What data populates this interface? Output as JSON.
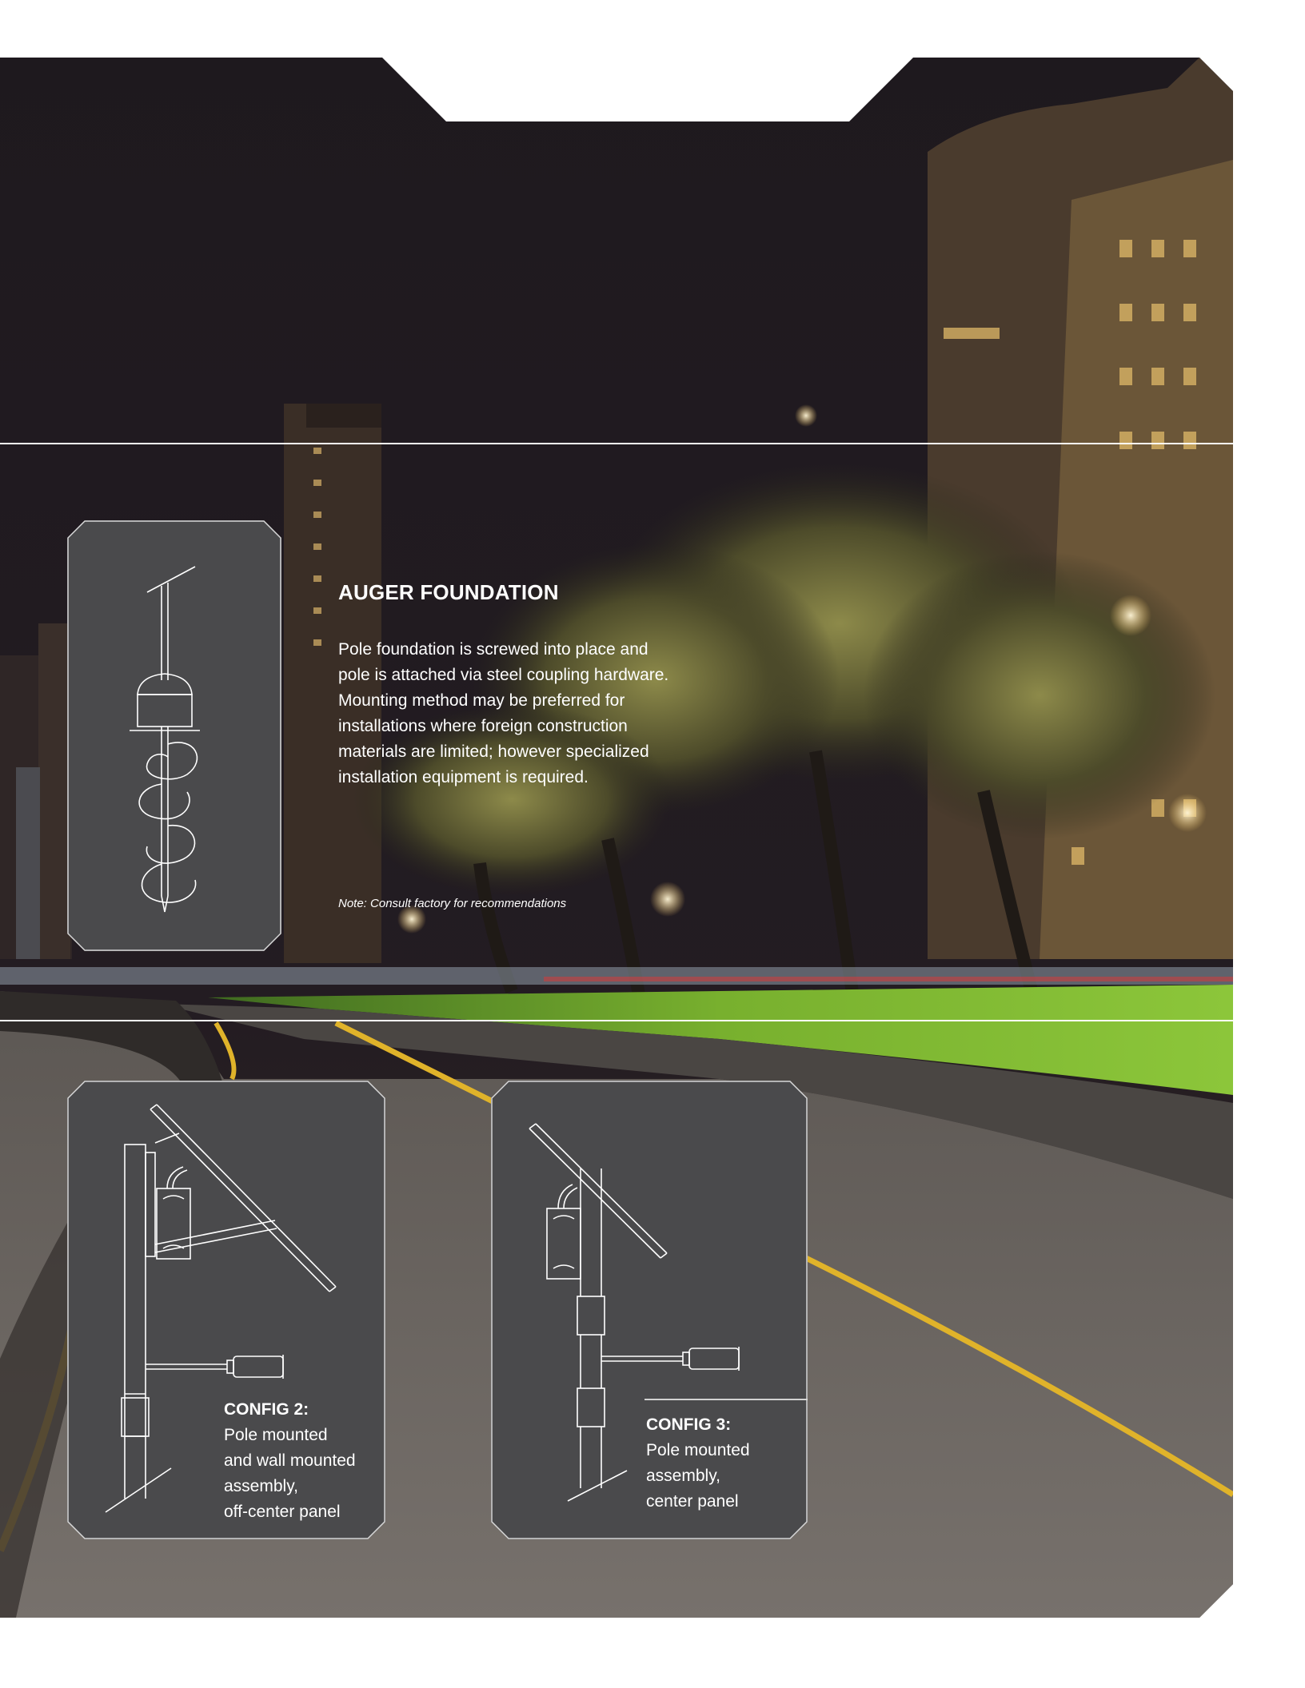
{
  "auger": {
    "heading": "AUGER FOUNDATION",
    "body_lines": [
      "Pole foundation is screwed into place and",
      "pole is attached via steel coupling hardware.",
      "Mounting method may be preferred for",
      "installations where foreign construction",
      "materials are limited; however specialized",
      "installation equipment is required."
    ],
    "note": "Note: Consult factory for recommendations"
  },
  "config2": {
    "title": "CONFIG 2:",
    "lines": [
      "Pole mounted",
      "and wall mounted",
      "assembly,",
      "off-center panel"
    ]
  },
  "config3": {
    "title": "CONFIG 3:",
    "lines": [
      "Pole mounted",
      "assembly,",
      "center panel"
    ]
  },
  "colors": {
    "panel": "#4a4a4c",
    "line_art": "#ffffff",
    "sky": "#201a1e",
    "grass": "#7fb531",
    "road_stripe": "#e0b32a"
  }
}
